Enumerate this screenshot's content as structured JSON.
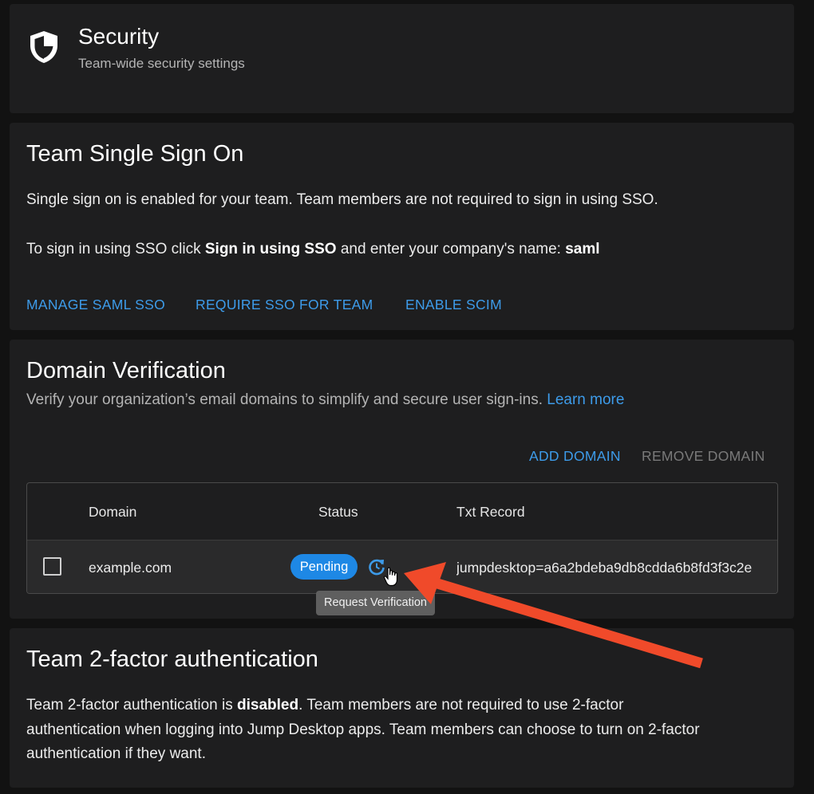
{
  "header": {
    "title": "Security",
    "subtitle": "Team-wide security settings",
    "icon": "shield-icon"
  },
  "sso": {
    "title": "Team Single Sign On",
    "status_text": "Single sign on is enabled for your team. Team members are not required to sign in using SSO.",
    "instruction_prefix": "To sign in using SSO click ",
    "instruction_bold": "Sign in using SSO",
    "instruction_middle": " and enter your company's name: ",
    "company_name": "saml",
    "actions": {
      "manage": "MANAGE SAML SSO",
      "require": "REQUIRE SSO FOR TEAM",
      "scim": "ENABLE SCIM"
    }
  },
  "domain": {
    "title": "Domain Verification",
    "description": "Verify your organization’s email domains to simplify and secure user sign-ins. ",
    "learn_more": "Learn more",
    "add_label": "ADD DOMAIN",
    "remove_label": "REMOVE DOMAIN",
    "columns": {
      "domain": "Domain",
      "status": "Status",
      "txt": "Txt Record"
    },
    "rows": [
      {
        "domain": "example.com",
        "status": "Pending",
        "txt": "jumpdesktop=a6a2bdeba9db8cdda6b8fd3f3c2e"
      }
    ],
    "tooltip": "Request Verification"
  },
  "twofa": {
    "title": "Team 2-factor authentication",
    "line1_prefix": "Team 2-factor authentication is ",
    "line1_bold": "disabled",
    "line1_suffix": ". Team members are not required to use 2-factor",
    "line2": "authentication when logging into Jump Desktop apps. Team members can choose to turn on 2-factor",
    "line3": "authentication if they want."
  },
  "colors": {
    "accent": "#3d9be9",
    "chip": "#1e88e5",
    "annotation_arrow": "#f04a2a",
    "card_bg": "#1e1e1f"
  }
}
